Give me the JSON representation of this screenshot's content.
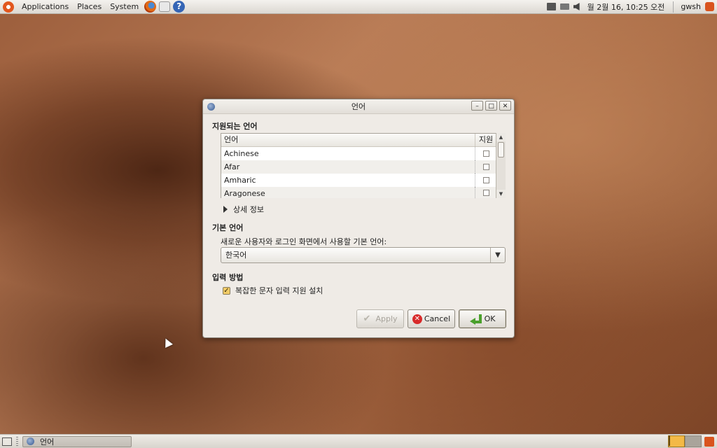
{
  "top_panel": {
    "menus": [
      "Applications",
      "Places",
      "System"
    ],
    "clock": "월  2월 16, 10:25 오전",
    "user": "gwsh"
  },
  "dialog": {
    "title": "언어",
    "supported_section": "지원되는 언어",
    "list": {
      "col_language": "언어",
      "col_support": "지원",
      "rows": [
        {
          "name": "Achinese"
        },
        {
          "name": "Afar"
        },
        {
          "name": "Amharic"
        },
        {
          "name": "Aragonese"
        }
      ]
    },
    "details_label": "상세 정보",
    "default_section": "기본 언어",
    "default_desc": "새로운 사용자와 로그인 화면에서 사용할 기본 언어:",
    "default_value": "한국어",
    "input_section": "입력 방법",
    "input_checkbox_label": "복잡한 문자 입력 지원 설치",
    "buttons": {
      "apply": "Apply",
      "cancel": "Cancel",
      "ok": "OK"
    }
  },
  "bottom_panel": {
    "task_label": "언어"
  }
}
